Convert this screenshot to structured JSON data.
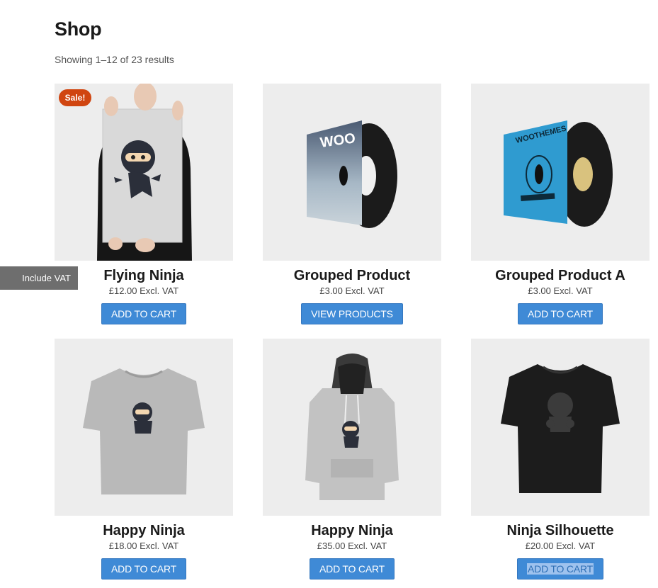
{
  "page": {
    "title": "Shop",
    "result_count": "Showing 1–12 of 23 results"
  },
  "vat_toggle": {
    "label": "Include VAT"
  },
  "products": [
    {
      "name": "Flying Ninja",
      "price": "£12.00 Excl. VAT",
      "button": "ADD TO CART",
      "badge": "Sale!",
      "image": "ninja-poster"
    },
    {
      "name": "Grouped Product",
      "price": "£3.00 Excl. VAT",
      "button": "VIEW PRODUCTS",
      "image": "woo-vinyl-album"
    },
    {
      "name": "Grouped Product A",
      "price": "£3.00 Excl. VAT",
      "button": "ADD TO CART",
      "image": "woothemes-vinyl-album"
    },
    {
      "name": "Happy Ninja",
      "price": "£18.00 Excl. VAT",
      "button": "ADD TO CART",
      "image": "grey-ninja-tshirt"
    },
    {
      "name": "Happy Ninja",
      "price": "£35.00 Excl. VAT",
      "button": "ADD TO CART",
      "image": "grey-ninja-hoodie"
    },
    {
      "name": "Ninja Silhouette",
      "price": "£20.00 Excl. VAT",
      "button": "ADD TO CART",
      "image": "black-silhouette-tshirt"
    }
  ],
  "colors": {
    "button": "#3f8ad6",
    "sale_badge": "#d04510",
    "vat_tab": "#6e6e6e",
    "thumb_bg": "#ededed"
  }
}
